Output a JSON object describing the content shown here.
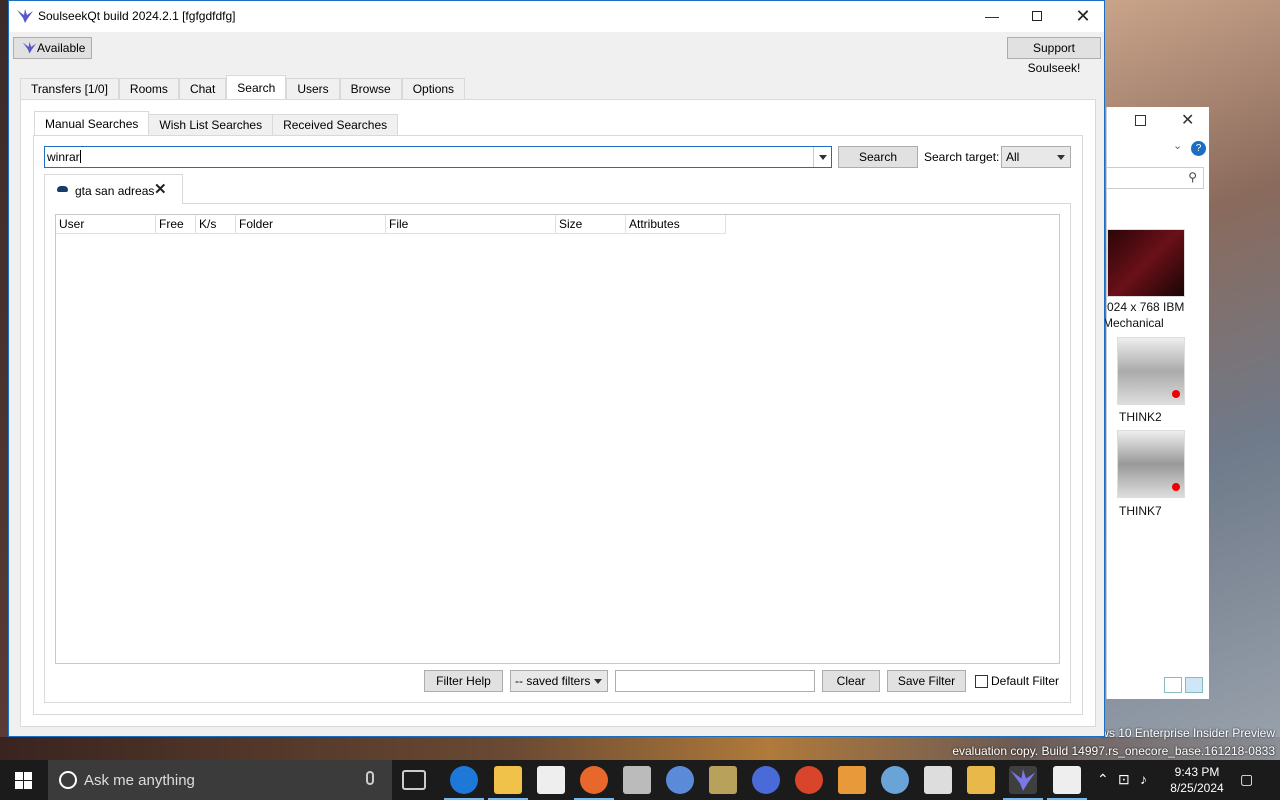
{
  "window": {
    "title": "SoulseekQt build 2024.2.1 [fgfgdfdfg]",
    "status_label": "Available",
    "support_label": "Support Soulseek!"
  },
  "main_tabs": [
    "Transfers [1/0]",
    "Rooms",
    "Chat",
    "Search",
    "Users",
    "Browse",
    "Options"
  ],
  "active_main_tab": "Search",
  "search_tabs": [
    "Manual Searches",
    "Wish List Searches",
    "Received Searches"
  ],
  "active_search_tab": "Manual Searches",
  "search": {
    "query_value": "winrar",
    "button_label": "Search",
    "target_label": "Search target:",
    "target_value": "All"
  },
  "result_tab": {
    "label": "gta san adreas"
  },
  "results_table": {
    "columns": [
      "User",
      "Free",
      "K/s",
      "Folder",
      "File",
      "Size",
      "Attributes"
    ],
    "rows": []
  },
  "filters": {
    "help_label": "Filter Help",
    "saved_filters_value": "-- saved filters",
    "filter_text": "",
    "clear_label": "Clear",
    "save_label": "Save Filter",
    "default_label": "Default Filter",
    "default_checked": false
  },
  "explorer": {
    "items": [
      {
        "label_line1": "024 x 768 IBM",
        "label_line2": "Mechanical"
      },
      {
        "label_line1": "THINK2"
      },
      {
        "label_line1": "THINK7"
      }
    ]
  },
  "desktop": {
    "watermark_line1": "ws 10 Enterprise Insider Preview",
    "watermark_line2": "evaluation copy. Build 14997.rs_onecore_base.161218-0833"
  },
  "taskbar": {
    "search_placeholder": "Ask me anything",
    "time": "9:43 PM",
    "date": "8/25/2024"
  },
  "colors": {
    "accent": "#1b6ec2",
    "taskbar": "#1b1b1b",
    "cortana": "#3b3b3b"
  }
}
